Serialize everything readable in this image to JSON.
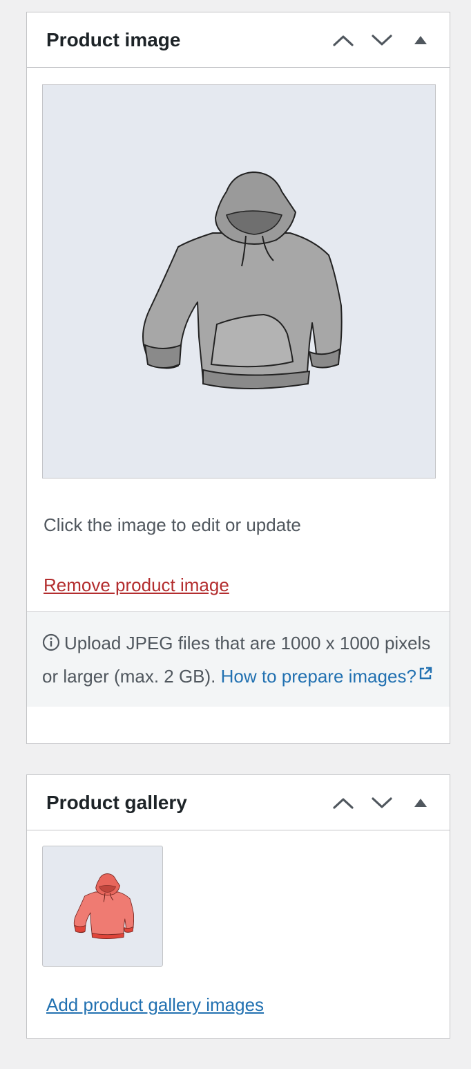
{
  "product_image": {
    "title": "Product image",
    "move_up_label": "Move up",
    "move_down_label": "Move down",
    "toggle_label": "Toggle panel",
    "image_alt": "Grey hoodie",
    "howto_text": "Click the image to edit or update",
    "remove_label": "Remove product image",
    "notice_text": "Upload JPEG files that are 1000 x 1000 pixels or larger (max. 2 GB).",
    "notice_link": "How to prepare images?"
  },
  "product_gallery": {
    "title": "Product gallery",
    "thumb_alt": "Red hoodie",
    "add_label": "Add product gallery images"
  },
  "colors": {
    "background": "#f0f0f1",
    "panel_border": "#c3c4c7",
    "image_bg": "#e5e9f0",
    "link_blue": "#2271b1",
    "link_red": "#b32d2e",
    "notice_bg": "#f3f5f6",
    "hoodie_grey": "#a7a7a7",
    "hoodie_red": "#ef7b72"
  },
  "icons": {
    "move_up": "chevron-up-icon",
    "move_down": "chevron-down-icon",
    "toggle": "triangle-up-icon",
    "info": "info-icon",
    "external": "external-link-icon"
  }
}
